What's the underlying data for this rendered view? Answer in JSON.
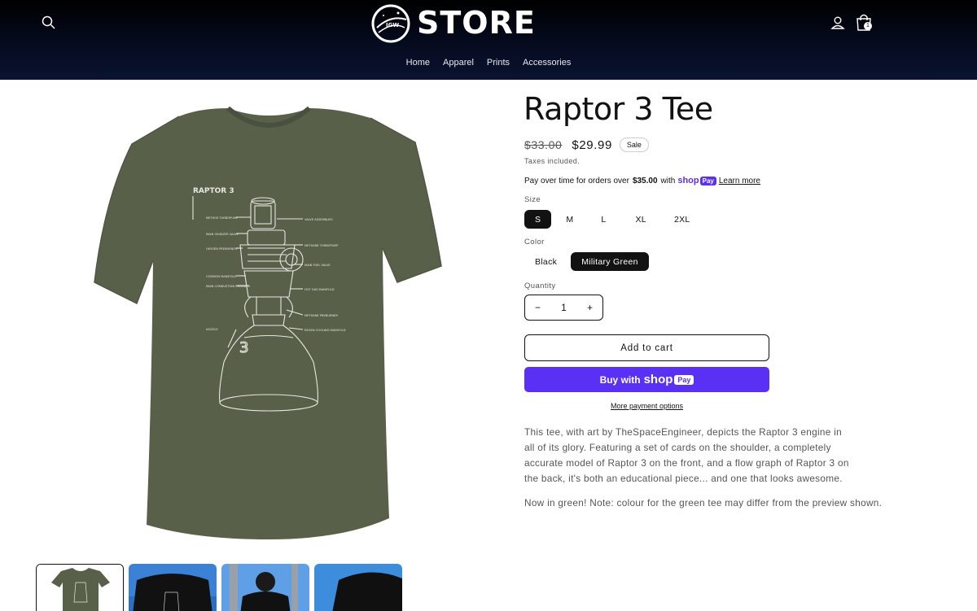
{
  "header": {
    "logo_text": "STORE",
    "logo_badge": "IGW",
    "cart_count": "1",
    "nav": [
      "Home",
      "Apparel",
      "Prints",
      "Accessories"
    ]
  },
  "product": {
    "title": "Raptor 3 Tee",
    "price_old": "$33.00",
    "price_new": "$29.99",
    "sale_badge": "Sale",
    "taxes": "Taxes included.",
    "payover_prefix": "Pay over time for orders over",
    "payover_amount": "$35.00",
    "payover_with": "with",
    "shoppay_shop": "shop",
    "shoppay_pay": "Pay",
    "learn_more": "Learn more",
    "size_label": "Size",
    "sizes": [
      "S",
      "M",
      "L",
      "XL",
      "2XL"
    ],
    "selected_size": "S",
    "color_label": "Color",
    "colors": [
      "Black",
      "Military Green"
    ],
    "selected_color": "Military Green",
    "quantity_label": "Quantity",
    "quantity": "1",
    "qty_minus": "−",
    "qty_plus": "+",
    "add_to_cart": "Add to cart",
    "buy_with": "Buy with",
    "more_payment": "More payment options",
    "description": [
      "This tee, with art by TheSpaceEngineer, depicts the Raptor 3 engine in all of its glory. Featuring a set of cards on the shoulder, a completely accurate model of Raptor 3 on the front, and a flow graph of Raptor 3 on the back, it's both an educational piece... and one that looks awesome.",
      "Now in green! Note: colour for the green tee may differ from the preview shown."
    ]
  },
  "shirt_art": {
    "heading": "RAPTOR 3",
    "labels_left": [
      "METHOX TURBOPUMP",
      "MAIN OXIDIZER VALVE",
      "OXYGEN PREBURNER",
      "COMMON MANIFOLD",
      "MAIN COMBUSTION CHAMBER",
      "NOZZLE"
    ],
    "labels_right": [
      "VALVE ASSEMBLIES",
      "METHANE TURBOPUMP",
      "MAIN FUEL VALVE",
      "HOT GAS MANIFOLD",
      "METHANE PREBURNER",
      "REGEN COOLING MANIFOLD"
    ],
    "nozzle_mark": "3"
  },
  "colors": {
    "header_bg": "#050b1f",
    "shirt": "#59604a",
    "shoppay": "#5a31f4"
  }
}
